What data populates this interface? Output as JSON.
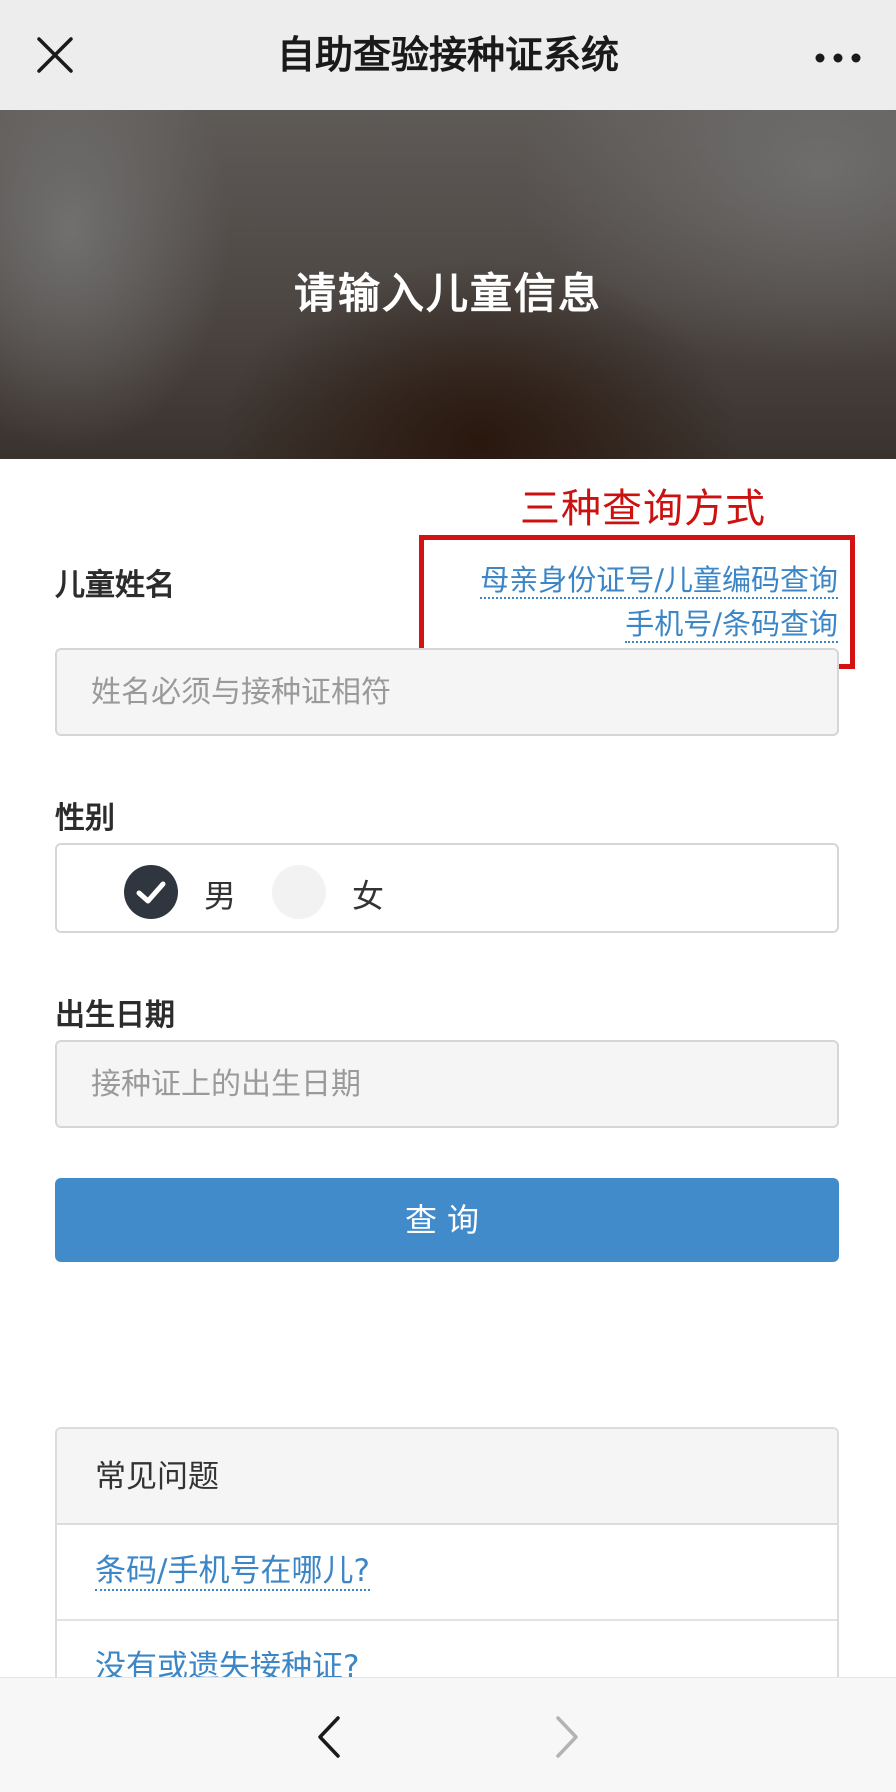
{
  "topbar": {
    "title": "自助查验接种证系统",
    "close_icon": "close-icon",
    "more_icon": "more-icon"
  },
  "banner": {
    "heading": "请输入儿童信息"
  },
  "annotation": {
    "text": "三种查询方式",
    "color": "#cc1111"
  },
  "form": {
    "name_label": "儿童姓名",
    "name_placeholder": "姓名必须与接种证相符",
    "alt_query_links": [
      "母亲身份证号/儿童编码查询",
      "手机号/条码查询"
    ],
    "gender_label": "性别",
    "gender_options": [
      {
        "label": "男",
        "selected": true
      },
      {
        "label": "女",
        "selected": false
      }
    ],
    "birth_label": "出生日期",
    "birth_placeholder": "接种证上的出生日期",
    "submit_label": "查询"
  },
  "faq": {
    "title": "常见问题",
    "items": [
      "条码/手机号在哪儿?",
      "没有或遗失接种证?"
    ]
  },
  "colors": {
    "primary": "#428bca",
    "link": "#3d86c6",
    "annotation_red": "#d41212"
  }
}
